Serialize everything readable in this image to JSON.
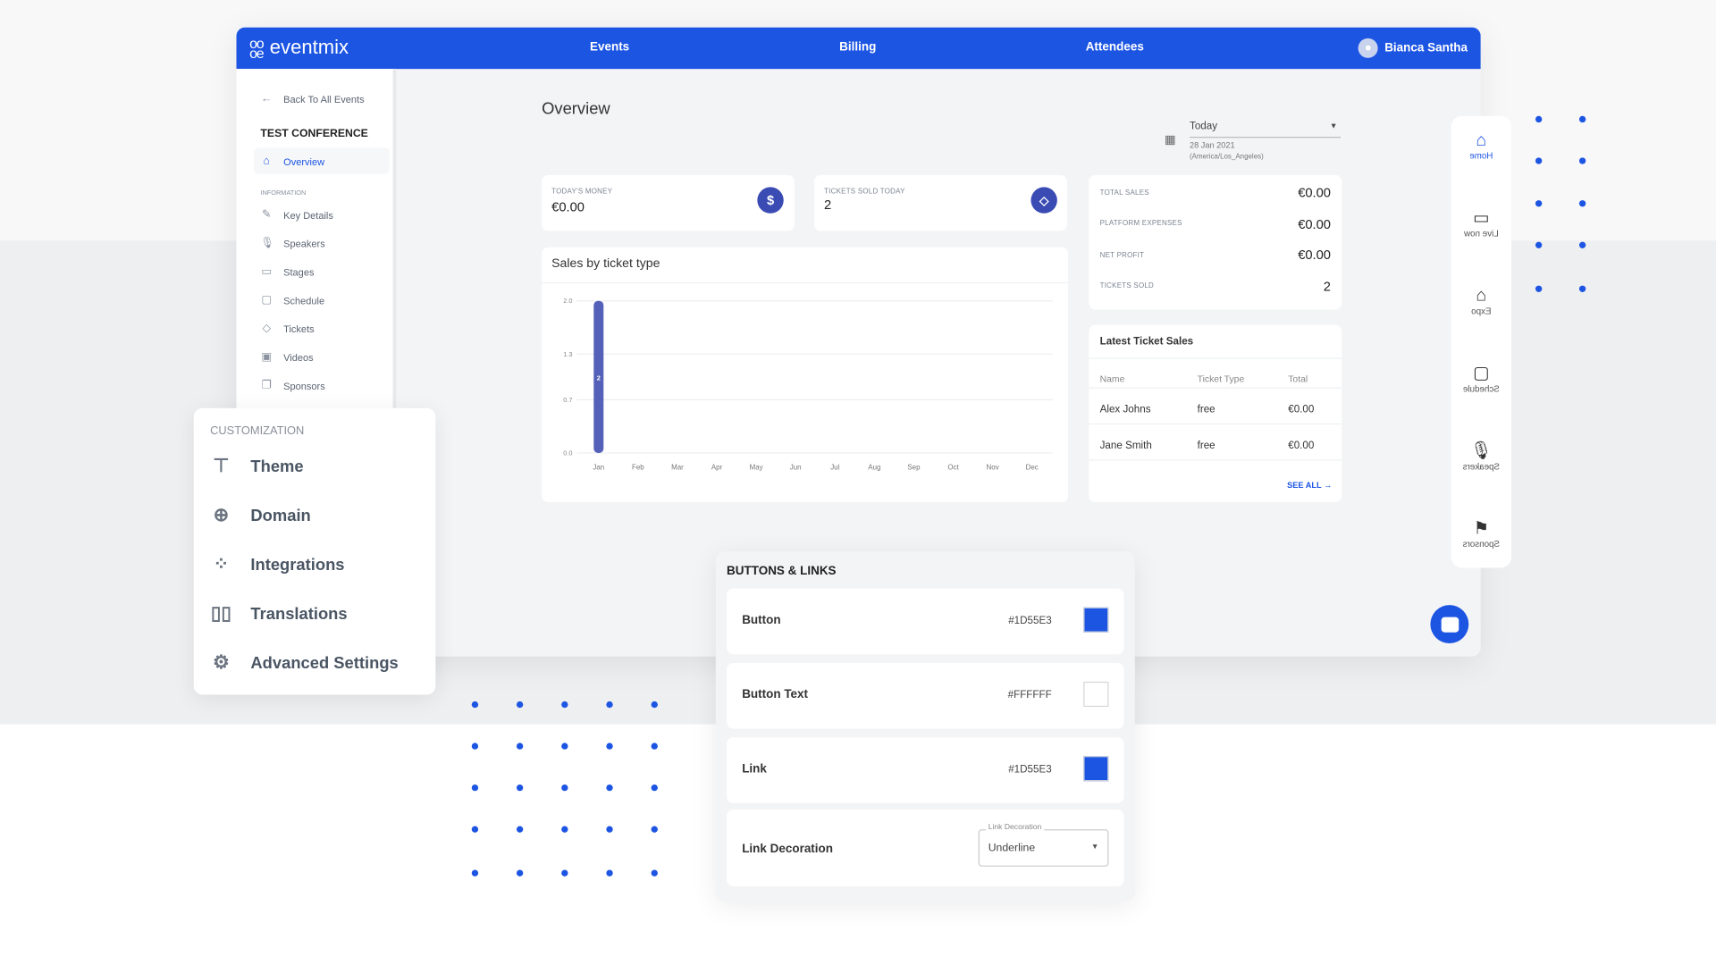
{
  "header": {
    "logo": "eventmix",
    "nav": [
      "Events",
      "Billing",
      "Attendees"
    ],
    "user": "Bianca Santha"
  },
  "sidebar": {
    "back": "Back To All Events",
    "event": "TEST CONFERENCE",
    "active": "Overview",
    "section": "INFORMATION",
    "items": [
      {
        "label": "Key Details",
        "icon": "pencil-icon"
      },
      {
        "label": "Speakers",
        "icon": "microphone-icon"
      },
      {
        "label": "Stages",
        "icon": "video-icon"
      },
      {
        "label": "Schedule",
        "icon": "calendar-icon"
      },
      {
        "label": "Tickets",
        "icon": "ticket-icon"
      },
      {
        "label": "Videos",
        "icon": "play-icon"
      },
      {
        "label": "Sponsors",
        "icon": "sponsor-icon"
      }
    ]
  },
  "main": {
    "title": "Overview",
    "date": {
      "range": "Today",
      "date": "28 Jan 2021",
      "tz": "(America/Los_Angeles)"
    },
    "stats": [
      {
        "label": "TODAY'S MONEY",
        "value": "€0.00",
        "icon": "dollar-icon"
      },
      {
        "label": "TICKETS SOLD TODAY",
        "value": "2",
        "icon": "ticket-icon"
      }
    ],
    "summary": [
      {
        "label": "TOTAL SALES",
        "value": "€0.00"
      },
      {
        "label": "PLATFORM EXPENSES",
        "value": "€0.00"
      },
      {
        "label": "NET PROFIT",
        "value": "€0.00"
      },
      {
        "label": "TICKETS SOLD",
        "value": "2"
      }
    ],
    "latest": {
      "title": "Latest Ticket Sales",
      "columns": [
        "Name",
        "Ticket Type",
        "Total"
      ],
      "rows": [
        [
          "Alex Johns",
          "free",
          "€0.00"
        ],
        [
          "Jane Smith",
          "free",
          "€0.00"
        ]
      ],
      "see_all": "SEE ALL"
    }
  },
  "chart_data": {
    "type": "bar",
    "title": "Sales by ticket type",
    "categories": [
      "Jan",
      "Feb",
      "Mar",
      "Apr",
      "May",
      "Jun",
      "Jul",
      "Aug",
      "Sep",
      "Oct",
      "Nov",
      "Dec"
    ],
    "values": [
      2,
      0,
      0,
      0,
      0,
      0,
      0,
      0,
      0,
      0,
      0,
      0
    ],
    "data_labels": [
      "2"
    ],
    "yticks": [
      "0.0",
      "0.7",
      "1.3",
      "2.0"
    ],
    "ylim": [
      0,
      2
    ],
    "grid": true,
    "color": "#5561b8"
  },
  "rail": [
    {
      "label": "Home",
      "icon": "home-icon",
      "active": true
    },
    {
      "label": "Live now",
      "icon": "video-icon"
    },
    {
      "label": "Expo",
      "icon": "store-icon"
    },
    {
      "label": "Schedule",
      "icon": "calendar-icon"
    },
    {
      "label": "Speakers",
      "icon": "microphone-icon"
    },
    {
      "label": "Sponsors",
      "icon": "flag-icon"
    }
  ],
  "customization": {
    "title": "CUSTOMIZATION",
    "items": [
      {
        "label": "Theme",
        "icon": "paintbrush-icon"
      },
      {
        "label": "Domain",
        "icon": "globe-icon"
      },
      {
        "label": "Integrations",
        "icon": "integrations-icon"
      },
      {
        "label": "Translations",
        "icon": "book-icon"
      },
      {
        "label": "Advanced Settings",
        "icon": "gear-icon"
      }
    ]
  },
  "buttons_links": {
    "title": "BUTTONS & LINKS",
    "rows": [
      {
        "label": "Button",
        "hex": "#1D55E3"
      },
      {
        "label": "Button Text",
        "hex": "#FFFFFF"
      },
      {
        "label": "Link",
        "hex": "#1D55E3"
      }
    ],
    "decoration": {
      "label": "Link Decoration",
      "field_label": "Link Decoration",
      "value": "Underline"
    }
  },
  "colors": {
    "brand": "#1d55e3",
    "accent": "#3a4bb3"
  }
}
